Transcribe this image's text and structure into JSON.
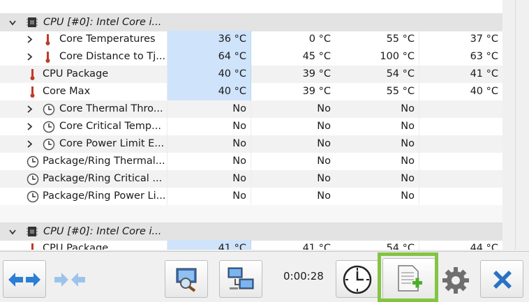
{
  "sensor_list": {
    "groups": [
      {
        "title": "CPU [#0]: Intel Core i...",
        "rows": [
          {
            "label": "Core Temperatures",
            "icon": "thermometer-icon",
            "expandable": true,
            "values": [
              "36 °C",
              "0 °C",
              "55 °C",
              "37 °C"
            ]
          },
          {
            "label": "Core Distance to Tj...",
            "icon": "thermometer-icon",
            "expandable": true,
            "values": [
              "64 °C",
              "45 °C",
              "100 °C",
              "63 °C"
            ]
          },
          {
            "label": "CPU Package",
            "icon": "thermometer-icon",
            "expandable": false,
            "values": [
              "40 °C",
              "39 °C",
              "54 °C",
              "41 °C"
            ]
          },
          {
            "label": "Core Max",
            "icon": "thermometer-icon",
            "expandable": false,
            "values": [
              "40 °C",
              "39 °C",
              "55 °C",
              "40 °C"
            ]
          },
          {
            "label": "Core Thermal Thro...",
            "icon": "clock-sensor-icon",
            "expandable": true,
            "values": [
              "No",
              "No",
              "No",
              ""
            ]
          },
          {
            "label": "Core Critical Temp...",
            "icon": "clock-sensor-icon",
            "expandable": true,
            "values": [
              "No",
              "No",
              "No",
              ""
            ]
          },
          {
            "label": "Core Power Limit E...",
            "icon": "clock-sensor-icon",
            "expandable": true,
            "values": [
              "No",
              "No",
              "No",
              ""
            ]
          },
          {
            "label": "Package/Ring Thermal...",
            "icon": "clock-sensor-icon",
            "expandable": false,
            "values": [
              "No",
              "No",
              "No",
              ""
            ]
          },
          {
            "label": "Package/Ring Critical ...",
            "icon": "clock-sensor-icon",
            "expandable": false,
            "values": [
              "No",
              "No",
              "No",
              ""
            ]
          },
          {
            "label": "Package/Ring Power Li...",
            "icon": "clock-sensor-icon",
            "expandable": false,
            "values": [
              "No",
              "No",
              "No",
              ""
            ]
          }
        ]
      },
      {
        "title": "CPU [#0]: Intel Core i...",
        "rows": [
          {
            "label": "CPU Package",
            "icon": "thermometer-icon",
            "expandable": false,
            "values": [
              "41 °C",
              "41 °C",
              "54 °C",
              "44 °C"
            ]
          }
        ]
      }
    ]
  },
  "toolbar": {
    "elapsed_time": "0:00:28",
    "buttons": [
      {
        "name": "layout-arrows-button",
        "icon": "double-arrow-icon"
      },
      {
        "name": "collapse-arrows-button",
        "icon": "converge-arrows-icon"
      },
      {
        "name": "sensor-search-button",
        "icon": "magnifier-monitor-icon"
      },
      {
        "name": "network-button",
        "icon": "network-computers-icon"
      },
      {
        "name": "reset-clock-button",
        "icon": "clock-icon"
      },
      {
        "name": "logging-button",
        "icon": "document-add-icon"
      },
      {
        "name": "settings-button",
        "icon": "gear-icon"
      },
      {
        "name": "close-button",
        "icon": "close-x-icon"
      }
    ],
    "highlight_color": "#84c443"
  }
}
